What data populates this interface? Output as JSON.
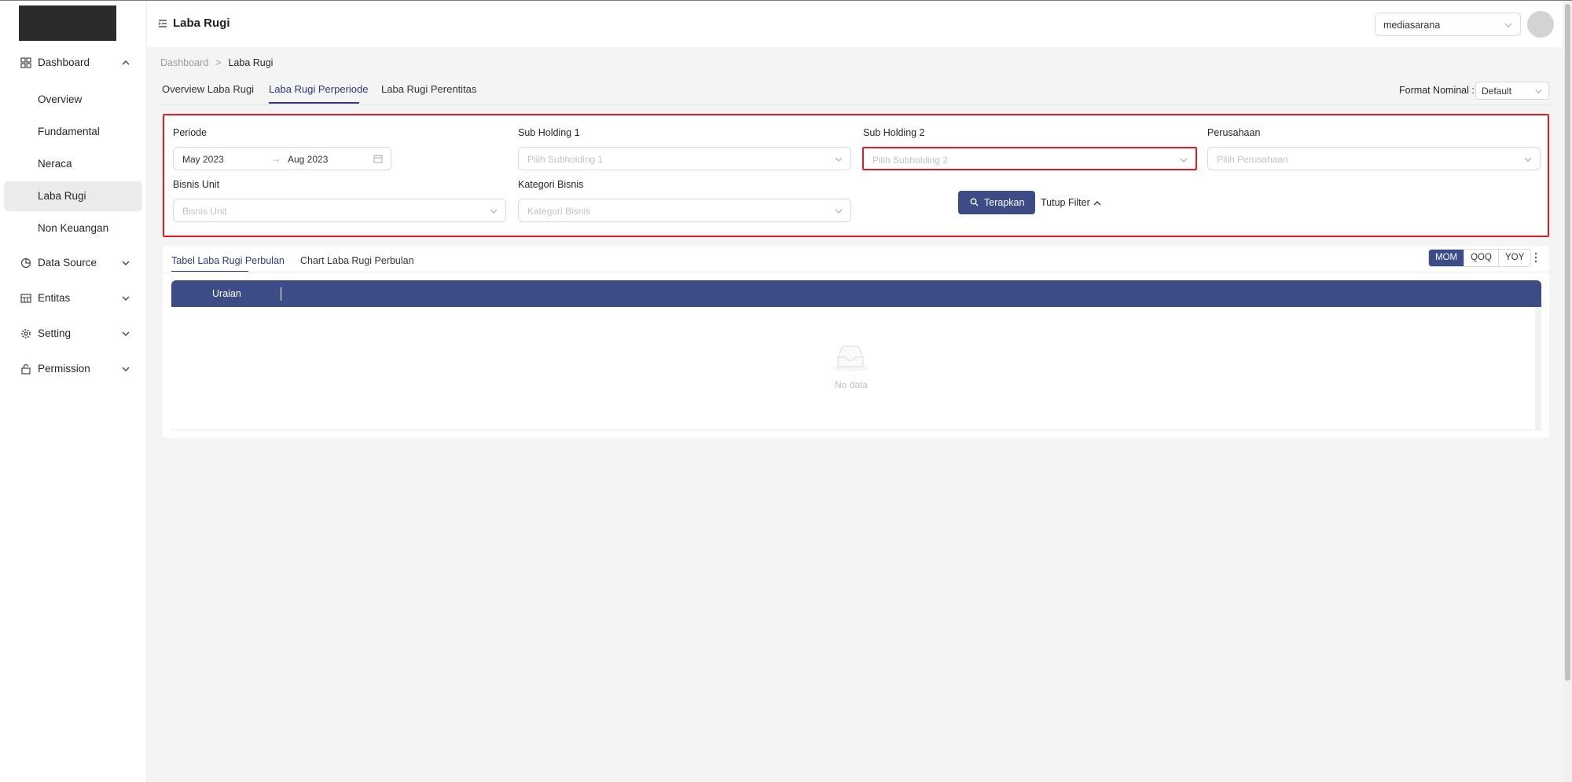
{
  "header": {
    "title": "Laba Rugi",
    "user_select": "mediasarana"
  },
  "sidebar": {
    "groups": [
      {
        "label": "Dashboard",
        "icon": "grid-icon"
      },
      {
        "label": "Data Source",
        "icon": "pie-chart-icon"
      },
      {
        "label": "Entitas",
        "icon": "table-icon"
      },
      {
        "label": "Setting",
        "icon": "gear-icon"
      },
      {
        "label": "Permission",
        "icon": "lock-icon"
      }
    ],
    "dashboard_items": [
      "Overview",
      "Fundamental",
      "Neraca",
      "Laba Rugi",
      "Non Keuangan"
    ],
    "active_item": "Laba Rugi"
  },
  "breadcrumb": {
    "root": "Dashboard",
    "separator": ">",
    "current": "Laba Rugi"
  },
  "tabs": [
    "Overview Laba Rugi",
    "Laba Rugi Perperiode",
    "Laba Rugi Perentitas"
  ],
  "active_tab": "Laba Rugi Perperiode",
  "format": {
    "label": "Format Nominal :",
    "value": "Default"
  },
  "filters": {
    "periode": {
      "label": "Periode",
      "start": "May 2023",
      "arrow": "→",
      "end": "Aug 2023"
    },
    "sub_holding_1": {
      "label": "Sub Holding 1",
      "placeholder": "Pilih Subholding 1"
    },
    "sub_holding_2": {
      "label": "Sub Holding 2",
      "placeholder": "Pilih Subholding 2"
    },
    "perusahaan": {
      "label": "Perusahaan",
      "placeholder": "Pilih Perusahaan"
    },
    "bisnis_unit": {
      "label": "Bisnis Unit",
      "placeholder": "Bisnis Unit"
    },
    "kategori_bisnis": {
      "label": "Kategori Bisnis",
      "placeholder": "Kategori Bisnis"
    },
    "apply_label": "Terapkan",
    "close_label": "Tutup Filter"
  },
  "table_card": {
    "tabs": [
      "Tabel Laba Rugi Perbulan",
      "Chart Laba Rugi Perbulan"
    ],
    "active_tab": "Tabel Laba Rugi Perbulan",
    "period_modes": [
      "MOM",
      "QOQ",
      "YOY"
    ],
    "active_mode": "MOM",
    "column_header": "Uraian",
    "empty_text": "No data"
  },
  "colors": {
    "accent": "#3d4b86",
    "highlight": "#e31b23"
  }
}
